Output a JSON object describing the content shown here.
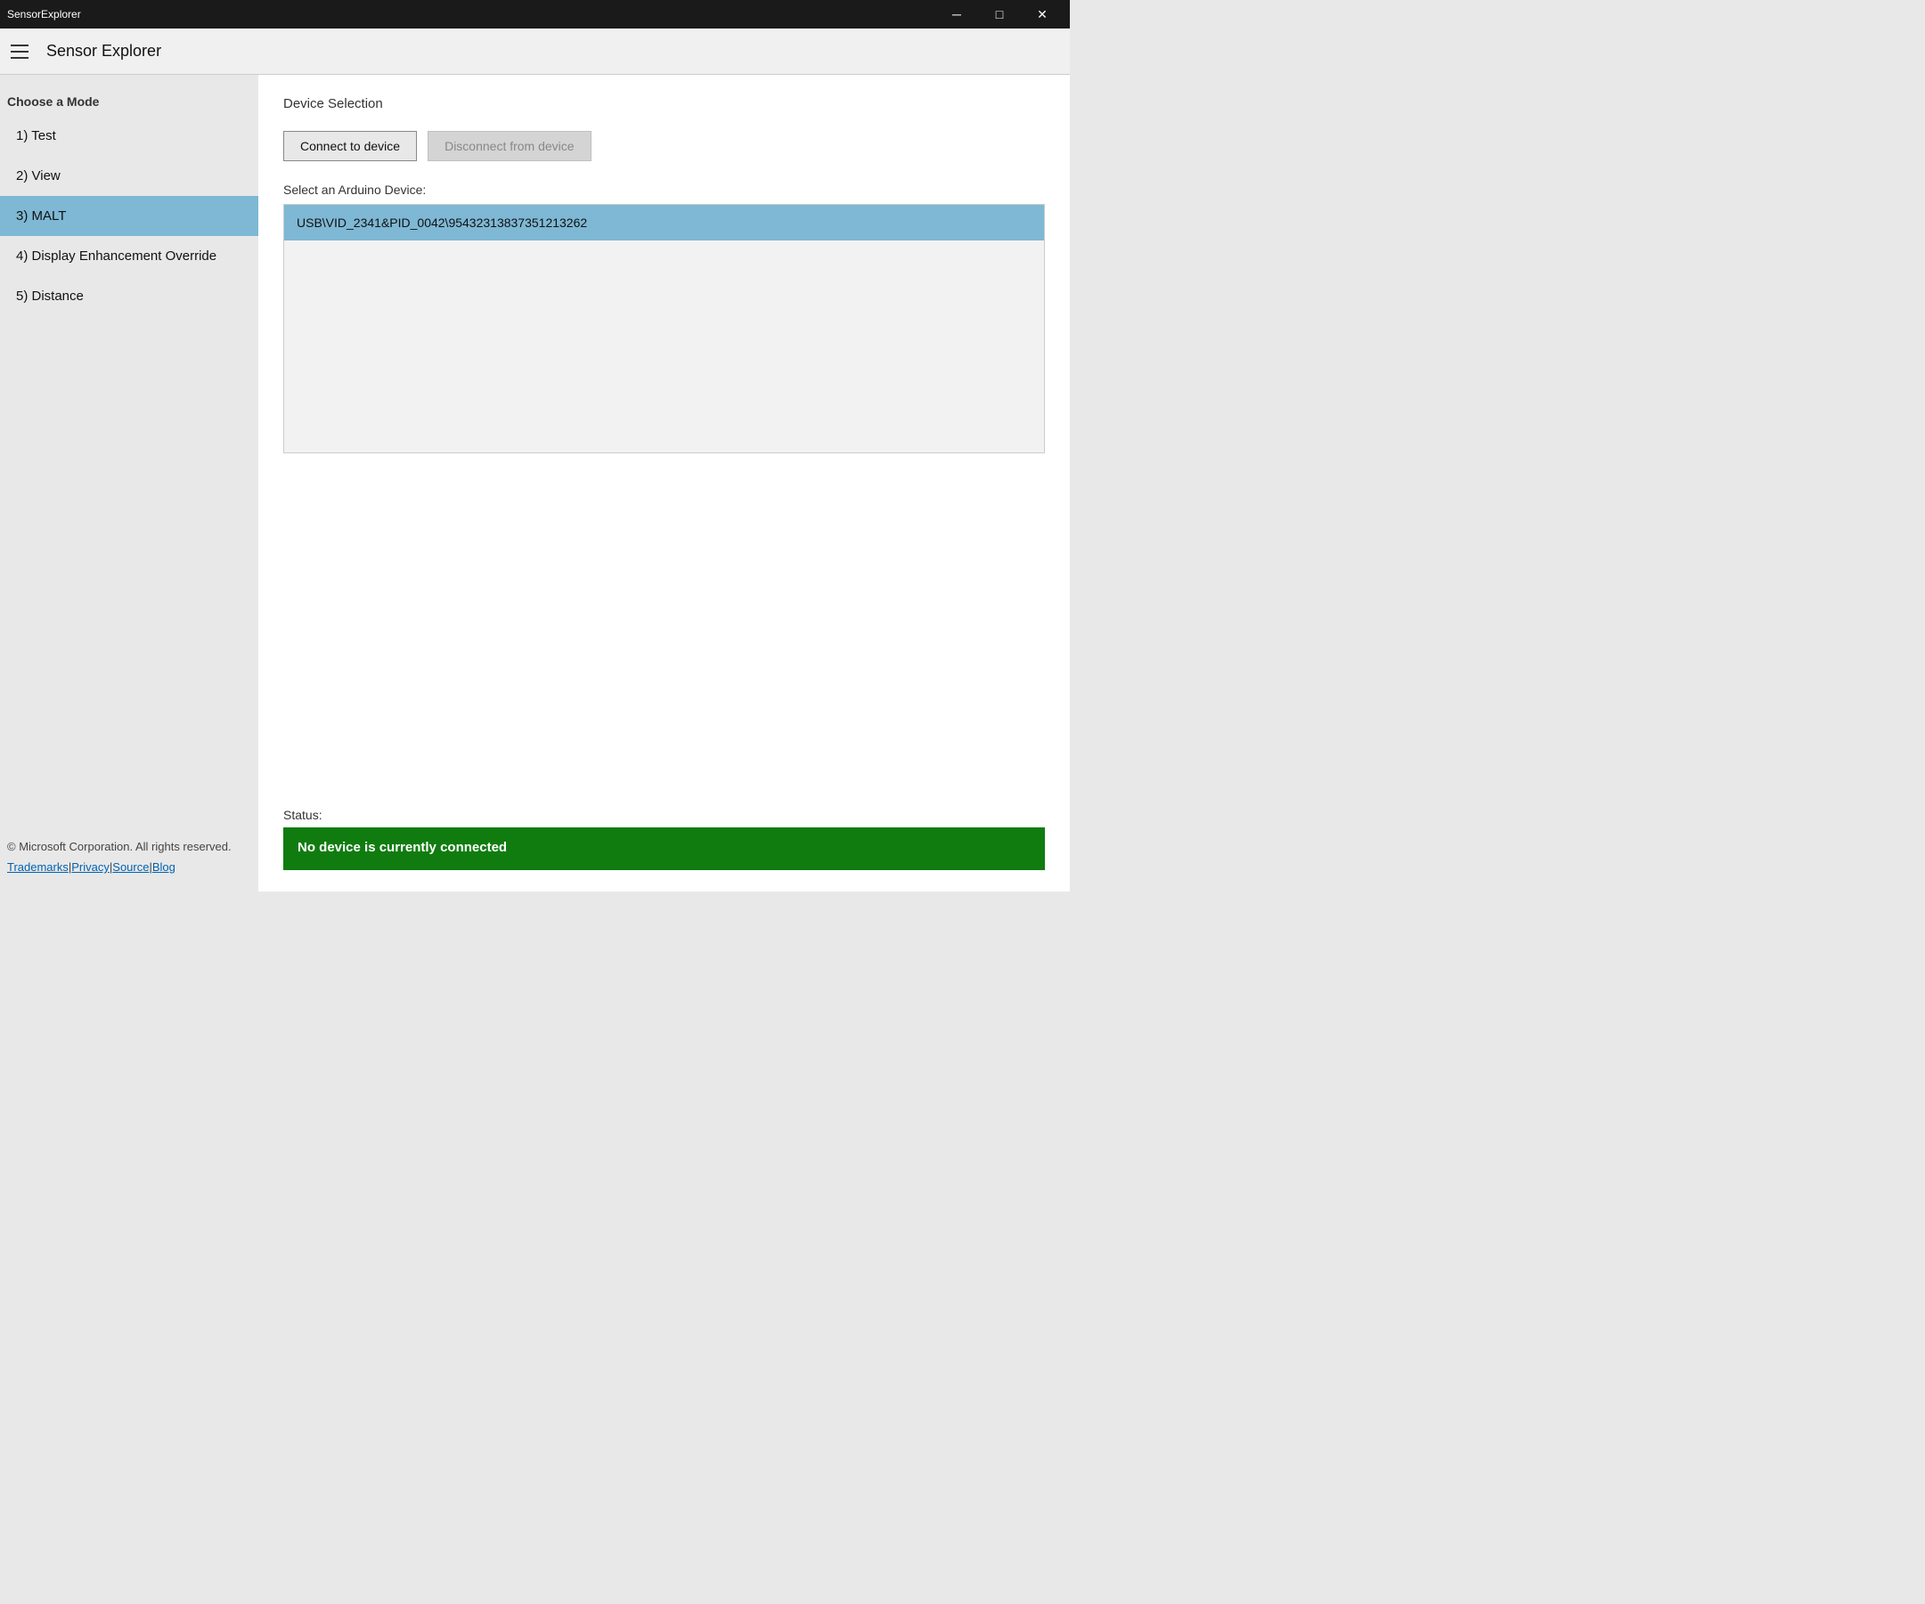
{
  "titleBar": {
    "appName": "SensorExplorer",
    "minimizeLabel": "─",
    "maximizeLabel": "□",
    "closeLabel": "✕"
  },
  "header": {
    "appTitle": "Sensor Explorer"
  },
  "sidebar": {
    "chooseMode": "Choose a Mode",
    "navItems": [
      {
        "label": "1) Test",
        "id": "test",
        "active": false
      },
      {
        "label": "2) View",
        "id": "view",
        "active": false
      },
      {
        "label": "3) MALT",
        "id": "malt",
        "active": true
      },
      {
        "label": "4) Display Enhancement Override",
        "id": "display",
        "active": false
      },
      {
        "label": "5) Distance",
        "id": "distance",
        "active": false
      }
    ],
    "footer": {
      "copyright": "© Microsoft Corporation. All rights reserved.",
      "links": [
        {
          "label": "Trademarks",
          "href": "#"
        },
        {
          "label": "Privacy",
          "href": "#"
        },
        {
          "label": "Source",
          "href": "#"
        },
        {
          "label": "Blog",
          "href": "#"
        }
      ]
    }
  },
  "content": {
    "sectionTitle": "Device Selection",
    "connectButton": "Connect to device",
    "disconnectButton": "Disconnect from device",
    "selectLabel": "Select an Arduino Device:",
    "deviceItems": [
      {
        "id": "device1",
        "label": "USB\\VID_2341&PID_0042\\95432313837351213262"
      }
    ],
    "statusLabel": "Status:",
    "statusMessage": "No device is currently connected"
  }
}
